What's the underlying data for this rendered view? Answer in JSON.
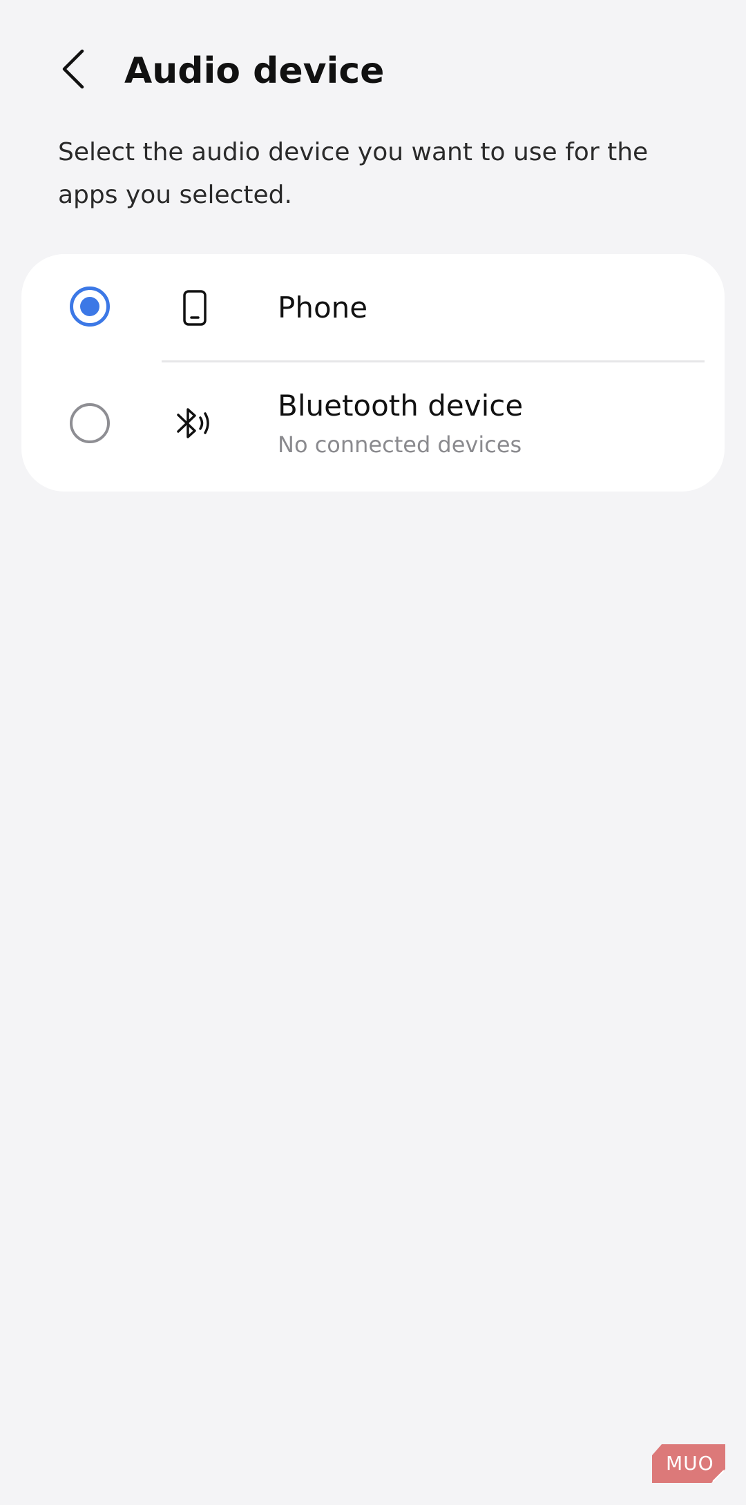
{
  "header": {
    "title": "Audio device",
    "back_icon": "chevron-left-icon"
  },
  "description": "Select the audio device you want to use for the apps you selected.",
  "options": [
    {
      "label": "Phone",
      "icon": "phone-icon",
      "selected": true
    },
    {
      "label": "Bluetooth device",
      "subtitle": "No connected devices",
      "icon": "bluetooth-audio-icon",
      "selected": false
    }
  ],
  "colors": {
    "background": "#f4f4f6",
    "card": "#ffffff",
    "accent": "#3c78e6",
    "radio_off": "#8e8e93",
    "subtitle": "#8a8a8e"
  },
  "watermark": {
    "text": "MUO",
    "color": "#d96c6c"
  }
}
